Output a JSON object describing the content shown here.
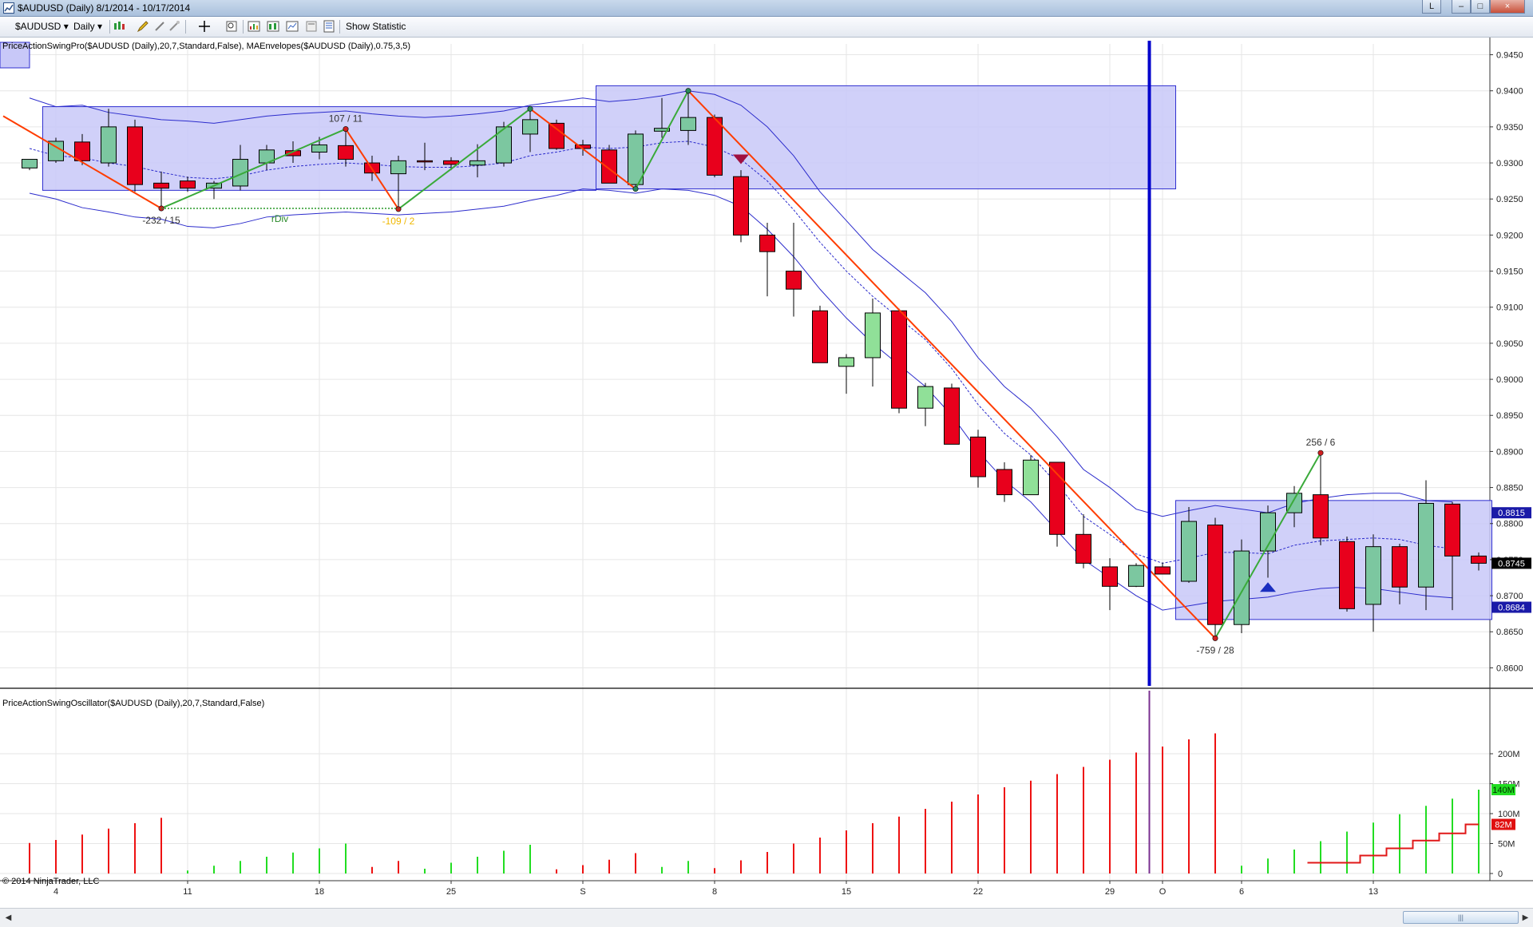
{
  "window": {
    "title": "$AUDUSD (Daily)  8/1/2014 - 10/17/2014",
    "buttons": [
      "L",
      "–",
      "□",
      "×"
    ]
  },
  "toolbar": {
    "instrument": "$AUDUSD",
    "period": "Daily",
    "show_statistic": "Show Statistic"
  },
  "price_panel": {
    "indicator_label": "PriceActionSwingPro($AUDUSD (Daily),20,7,Standard,False), MAEnvelopes($AUDUSD (Daily),0.75,3,5)",
    "copyright": "© 2014 NinjaTrader, LLC"
  },
  "oscillator_panel": {
    "indicator_label": "PriceActionSwingOscillator($AUDUSD (Daily),20,7,Standard,False)"
  },
  "colors": {
    "up_candle": "#7cc7a0",
    "up_candle_light": "#90e098",
    "down_candle": "#e8001c",
    "swing_up": "#3aaa3a",
    "swing_down": "#ff3c00",
    "box_fill": "#c8c8f8",
    "box_edge": "#3030d0",
    "envelope": "#2c2ccc",
    "marker_line": "#0000cc",
    "volume_up": "#22dd22",
    "volume_down": "#ee1111",
    "tag_blue": "#1a1aa8",
    "tag_black": "#000000",
    "tag_green": "#22dd22",
    "tag_red": "#e01010"
  },
  "chart_data": [
    {
      "type": "candlestick",
      "symbol": "$AUDUSD",
      "timeframe": "Daily",
      "ylim": [
        0.8575,
        0.9465
      ],
      "y_ticks": [
        "0.9450",
        "0.9400",
        "0.9350",
        "0.9300",
        "0.9250",
        "0.9200",
        "0.9150",
        "0.9100",
        "0.9050",
        "0.9000",
        "0.8950",
        "0.8900",
        "0.8850",
        "0.8800",
        "0.8750",
        "0.8700",
        "0.8650",
        "0.8600"
      ],
      "x_tick_labels": [
        "4",
        "11",
        "18",
        "25",
        "S",
        "8",
        "15",
        "22",
        "29",
        "O",
        "6",
        "13"
      ],
      "x_tick_index": [
        1,
        6,
        11,
        16,
        21,
        26,
        31,
        36,
        41,
        43,
        46,
        51
      ],
      "candles": [
        {
          "o": 0.9293,
          "h": 0.9305,
          "l": 0.929,
          "c": 0.9305
        },
        {
          "o": 0.9303,
          "h": 0.9335,
          "l": 0.93,
          "c": 0.933
        },
        {
          "o": 0.9329,
          "h": 0.934,
          "l": 0.9297,
          "c": 0.9303
        },
        {
          "o": 0.93,
          "h": 0.9375,
          "l": 0.9295,
          "c": 0.935
        },
        {
          "o": 0.935,
          "h": 0.936,
          "l": 0.926,
          "c": 0.927
        },
        {
          "o": 0.9272,
          "h": 0.9288,
          "l": 0.9238,
          "c": 0.9265
        },
        {
          "o": 0.9275,
          "h": 0.9281,
          "l": 0.926,
          "c": 0.9265
        },
        {
          "o": 0.9265,
          "h": 0.9275,
          "l": 0.925,
          "c": 0.9272
        },
        {
          "o": 0.9268,
          "h": 0.9325,
          "l": 0.9262,
          "c": 0.9305
        },
        {
          "o": 0.93,
          "h": 0.9325,
          "l": 0.929,
          "c": 0.9318
        },
        {
          "o": 0.9317,
          "h": 0.933,
          "l": 0.93,
          "c": 0.931
        },
        {
          "o": 0.9315,
          "h": 0.9336,
          "l": 0.9305,
          "c": 0.9325
        },
        {
          "o": 0.9324,
          "h": 0.9347,
          "l": 0.9295,
          "c": 0.9305
        },
        {
          "o": 0.93,
          "h": 0.931,
          "l": 0.9275,
          "c": 0.9286
        },
        {
          "o": 0.9285,
          "h": 0.931,
          "l": 0.9238,
          "c": 0.9303
        },
        {
          "o": 0.9303,
          "h": 0.9328,
          "l": 0.929,
          "c": 0.9302
        },
        {
          "o": 0.9303,
          "h": 0.9308,
          "l": 0.929,
          "c": 0.9298
        },
        {
          "o": 0.9297,
          "h": 0.9326,
          "l": 0.928,
          "c": 0.9303
        },
        {
          "o": 0.93,
          "h": 0.9357,
          "l": 0.9295,
          "c": 0.935
        },
        {
          "o": 0.934,
          "h": 0.9378,
          "l": 0.9315,
          "c": 0.936
        },
        {
          "o": 0.9355,
          "h": 0.936,
          "l": 0.9318,
          "c": 0.932
        },
        {
          "o": 0.9325,
          "h": 0.9332,
          "l": 0.931,
          "c": 0.932
        },
        {
          "o": 0.9318,
          "h": 0.9325,
          "l": 0.9275,
          "c": 0.9272
        },
        {
          "o": 0.927,
          "h": 0.9345,
          "l": 0.9262,
          "c": 0.934
        },
        {
          "o": 0.9344,
          "h": 0.939,
          "l": 0.9335,
          "c": 0.9348
        },
        {
          "o": 0.9345,
          "h": 0.94,
          "l": 0.9325,
          "c": 0.9363
        },
        {
          "o": 0.9363,
          "h": 0.9367,
          "l": 0.928,
          "c": 0.9283
        },
        {
          "o": 0.9281,
          "h": 0.929,
          "l": 0.919,
          "c": 0.92
        },
        {
          "o": 0.92,
          "h": 0.9217,
          "l": 0.9115,
          "c": 0.9177
        },
        {
          "o": 0.915,
          "h": 0.9217,
          "l": 0.9087,
          "c": 0.9125
        },
        {
          "o": 0.9095,
          "h": 0.9102,
          "l": 0.9023,
          "c": 0.9023
        },
        {
          "o": 0.9018,
          "h": 0.9035,
          "l": 0.898,
          "c": 0.903
        },
        {
          "o": 0.903,
          "h": 0.9112,
          "l": 0.899,
          "c": 0.9092
        },
        {
          "o": 0.9095,
          "h": 0.9098,
          "l": 0.8953,
          "c": 0.896
        },
        {
          "o": 0.896,
          "h": 0.8995,
          "l": 0.8935,
          "c": 0.899
        },
        {
          "o": 0.8988,
          "h": 0.8994,
          "l": 0.891,
          "c": 0.891
        },
        {
          "o": 0.892,
          "h": 0.893,
          "l": 0.885,
          "c": 0.8865
        },
        {
          "o": 0.8875,
          "h": 0.8885,
          "l": 0.883,
          "c": 0.884
        },
        {
          "o": 0.884,
          "h": 0.8895,
          "l": 0.884,
          "c": 0.8888
        },
        {
          "o": 0.8885,
          "h": 0.8885,
          "l": 0.8768,
          "c": 0.8785
        },
        {
          "o": 0.8785,
          "h": 0.8813,
          "l": 0.8738,
          "c": 0.8745
        },
        {
          "o": 0.874,
          "h": 0.8752,
          "l": 0.868,
          "c": 0.8713
        },
        {
          "o": 0.8713,
          "h": 0.8745,
          "l": 0.8712,
          "c": 0.8742
        },
        {
          "o": 0.874,
          "h": 0.8746,
          "l": 0.873,
          "c": 0.873
        },
        {
          "o": 0.872,
          "h": 0.8823,
          "l": 0.8718,
          "c": 0.8803
        },
        {
          "o": 0.8798,
          "h": 0.8808,
          "l": 0.864,
          "c": 0.866
        },
        {
          "o": 0.866,
          "h": 0.8778,
          "l": 0.8648,
          "c": 0.8762
        },
        {
          "o": 0.8762,
          "h": 0.8825,
          "l": 0.8725,
          "c": 0.8815
        },
        {
          "o": 0.8815,
          "h": 0.8852,
          "l": 0.8795,
          "c": 0.8842
        },
        {
          "o": 0.884,
          "h": 0.89,
          "l": 0.877,
          "c": 0.878
        },
        {
          "o": 0.8775,
          "h": 0.8782,
          "l": 0.8678,
          "c": 0.8682
        },
        {
          "o": 0.8688,
          "h": 0.8785,
          "l": 0.865,
          "c": 0.8768
        },
        {
          "o": 0.8768,
          "h": 0.8772,
          "l": 0.8688,
          "c": 0.8712
        },
        {
          "o": 0.8712,
          "h": 0.886,
          "l": 0.868,
          "c": 0.8828
        },
        {
          "o": 0.8827,
          "h": 0.883,
          "l": 0.868,
          "c": 0.8755
        },
        {
          "o": 0.8755,
          "h": 0.876,
          "l": 0.8735,
          "c": 0.8745
        }
      ],
      "light_up_candles": [
        31,
        32,
        34,
        38,
        43
      ],
      "envelope": {
        "upper": [
          0.939,
          0.9378,
          0.938,
          0.937,
          0.9365,
          0.936,
          0.9358,
          0.9355,
          0.936,
          0.9365,
          0.9368,
          0.937,
          0.9372,
          0.9368,
          0.9365,
          0.9363,
          0.9365,
          0.9368,
          0.9372,
          0.938,
          0.9385,
          0.939,
          0.9385,
          0.9388,
          0.9393,
          0.94,
          0.9395,
          0.938,
          0.935,
          0.931,
          0.926,
          0.922,
          0.918,
          0.915,
          0.912,
          0.908,
          0.903,
          0.899,
          0.896,
          0.892,
          0.8875,
          0.885,
          0.882,
          0.881,
          0.8818,
          0.8825,
          0.882,
          0.8815,
          0.8828,
          0.8835,
          0.884,
          0.8842,
          0.8842,
          0.8832,
          0.883
        ],
        "middle": [
          0.932,
          0.931,
          0.9307,
          0.93,
          0.9295,
          0.9287,
          0.928,
          0.9278,
          0.9282,
          0.929,
          0.9295,
          0.9298,
          0.93,
          0.9298,
          0.9295,
          0.9294,
          0.9294,
          0.9296,
          0.93,
          0.931,
          0.9315,
          0.9322,
          0.932,
          0.9322,
          0.9328,
          0.933,
          0.9322,
          0.9305,
          0.9275,
          0.9235,
          0.919,
          0.915,
          0.9115,
          0.9085,
          0.9055,
          0.9015,
          0.8965,
          0.8925,
          0.8895,
          0.8855,
          0.881,
          0.8785,
          0.8758,
          0.8745,
          0.8752,
          0.876,
          0.876,
          0.8758,
          0.877,
          0.8776,
          0.8778,
          0.878,
          0.8778,
          0.877,
          0.8765
        ],
        "lower": [
          0.9258,
          0.925,
          0.9238,
          0.9232,
          0.9225,
          0.9222,
          0.9212,
          0.921,
          0.9216,
          0.9225,
          0.9228,
          0.923,
          0.9232,
          0.923,
          0.9228,
          0.923,
          0.9232,
          0.9236,
          0.924,
          0.9248,
          0.9255,
          0.9264,
          0.9262,
          0.9258,
          0.9264,
          0.9262,
          0.9255,
          0.924,
          0.9208,
          0.917,
          0.9125,
          0.9085,
          0.905,
          0.902,
          0.899,
          0.895,
          0.89,
          0.886,
          0.883,
          0.879,
          0.875,
          0.8725,
          0.87,
          0.868,
          0.8686,
          0.8692,
          0.8695,
          0.8698,
          0.8705,
          0.871,
          0.8712,
          0.871,
          0.8705,
          0.87,
          0.8697
        ]
      },
      "consolidation_boxes": [
        {
          "from": 0.5,
          "to": 21.5,
          "top": 0.9378,
          "bottom": 0.9262
        },
        {
          "from": 21.5,
          "to": 43.5,
          "top": 0.9407,
          "bottom": 0.9264
        },
        {
          "from": 43.5,
          "to": 55.5,
          "top": 0.8832,
          "bottom": 0.8667
        }
      ],
      "zigzag": [
        {
          "i": -1,
          "v": 0.9365,
          "dir": "down"
        },
        {
          "i": 5,
          "v": 0.9237,
          "dir": "up"
        },
        {
          "i": 12,
          "v": 0.9347,
          "dir": "down"
        },
        {
          "i": 14,
          "v": 0.9236,
          "dir": "up"
        },
        {
          "i": 19,
          "v": 0.9375,
          "dir": "down"
        },
        {
          "i": 23,
          "v": 0.9264,
          "dir": "up"
        },
        {
          "i": 25,
          "v": 0.94,
          "dir": "down"
        },
        {
          "i": 45,
          "v": 0.8641,
          "dir": "up"
        },
        {
          "i": 49,
          "v": 0.8898,
          "dir": "end"
        }
      ],
      "swing_labels": [
        {
          "i": 5,
          "v": 0.9237,
          "text": "-232 / 15",
          "pos": "below",
          "color": "#333333"
        },
        {
          "i": 12,
          "v": 0.9347,
          "text": "107 / 11",
          "pos": "above",
          "color": "#333333"
        },
        {
          "i": 14,
          "v": 0.9236,
          "text": "-109 / 2",
          "pos": "below",
          "color": "#f0b800"
        },
        {
          "i": 45,
          "v": 0.8641,
          "text": "-759 / 28",
          "pos": "below",
          "color": "#333333"
        },
        {
          "i": 49,
          "v": 0.8898,
          "text": "256 / 6",
          "pos": "above",
          "color": "#333333"
        }
      ],
      "divergence": {
        "from": 5,
        "to": 14,
        "v": 0.9237,
        "label": "rDiv",
        "label_i": 9.5
      },
      "signals": [
        {
          "i": 27,
          "v": 0.9305,
          "shape": "down-triangle",
          "color": "#a01040"
        },
        {
          "i": 47,
          "v": 0.8712,
          "shape": "up-triangle",
          "color": "#1a2ec0"
        }
      ],
      "vertical_marker_i": 42.5,
      "price_tags": [
        {
          "v": 0.8815,
          "text": "0.8815",
          "color": "tag_blue"
        },
        {
          "v": 0.8745,
          "text": "0.8745",
          "color": "tag_black"
        },
        {
          "v": 0.8684,
          "text": "0.8684",
          "color": "tag_blue"
        }
      ]
    },
    {
      "type": "bar",
      "title": "PriceActionSwingOscillator",
      "ylim": [
        0,
        250
      ],
      "y_ticks": [
        "200M",
        "150M",
        "100M",
        "50M",
        "0"
      ],
      "bars": [
        {
          "v": 51,
          "c": "down"
        },
        {
          "v": 56,
          "c": "down"
        },
        {
          "v": 65,
          "c": "down"
        },
        {
          "v": 75,
          "c": "down"
        },
        {
          "v": 84,
          "c": "down"
        },
        {
          "v": 93,
          "c": "down"
        },
        {
          "v": 5,
          "c": "up"
        },
        {
          "v": 13,
          "c": "up"
        },
        {
          "v": 21,
          "c": "up"
        },
        {
          "v": 28,
          "c": "up"
        },
        {
          "v": 35,
          "c": "up"
        },
        {
          "v": 42,
          "c": "up"
        },
        {
          "v": 50,
          "c": "up"
        },
        {
          "v": 11,
          "c": "down"
        },
        {
          "v": 21,
          "c": "down"
        },
        {
          "v": 8,
          "c": "up"
        },
        {
          "v": 18,
          "c": "up"
        },
        {
          "v": 28,
          "c": "up"
        },
        {
          "v": 38,
          "c": "up"
        },
        {
          "v": 48,
          "c": "up"
        },
        {
          "v": 7,
          "c": "down"
        },
        {
          "v": 14,
          "c": "down"
        },
        {
          "v": 23,
          "c": "down"
        },
        {
          "v": 34,
          "c": "down"
        },
        {
          "v": 11,
          "c": "up"
        },
        {
          "v": 21,
          "c": "up"
        },
        {
          "v": 9,
          "c": "down"
        },
        {
          "v": 22,
          "c": "down"
        },
        {
          "v": 36,
          "c": "down"
        },
        {
          "v": 50,
          "c": "down"
        },
        {
          "v": 60,
          "c": "down"
        },
        {
          "v": 72,
          "c": "down"
        },
        {
          "v": 84,
          "c": "down"
        },
        {
          "v": 95,
          "c": "down"
        },
        {
          "v": 108,
          "c": "down"
        },
        {
          "v": 120,
          "c": "down"
        },
        {
          "v": 132,
          "c": "down"
        },
        {
          "v": 144,
          "c": "down"
        },
        {
          "v": 155,
          "c": "down"
        },
        {
          "v": 166,
          "c": "down"
        },
        {
          "v": 178,
          "c": "down"
        },
        {
          "v": 190,
          "c": "down"
        },
        {
          "v": 202,
          "c": "down"
        },
        {
          "v": 212,
          "c": "down"
        },
        {
          "v": 224,
          "c": "down"
        },
        {
          "v": 234,
          "c": "down"
        },
        {
          "v": 13,
          "c": "up"
        },
        {
          "v": 25,
          "c": "up"
        },
        {
          "v": 40,
          "c": "up"
        },
        {
          "v": 54,
          "c": "up"
        },
        {
          "v": 70,
          "c": "up"
        },
        {
          "v": 85,
          "c": "up"
        },
        {
          "v": 99,
          "c": "up"
        },
        {
          "v": 113,
          "c": "up"
        },
        {
          "v": 125,
          "c": "up"
        },
        {
          "v": 140,
          "c": "up"
        }
      ],
      "bars_x_index": [
        0,
        1,
        2,
        3,
        4,
        5,
        6,
        7,
        8,
        9,
        10,
        11,
        12,
        13,
        14,
        15,
        16,
        17,
        18,
        19,
        20,
        21,
        22,
        23,
        24,
        25,
        26,
        27,
        28,
        29,
        30,
        31,
        32,
        33,
        34,
        35,
        36,
        37,
        38,
        39,
        40,
        41,
        42,
        43,
        44,
        45,
        46,
        47,
        48,
        49,
        50,
        51,
        52,
        53,
        54,
        55
      ],
      "step_line": [
        {
          "i": 49.5,
          "v": 18
        },
        {
          "i": 50.5,
          "v": 30
        },
        {
          "i": 51.5,
          "v": 42
        },
        {
          "i": 52.5,
          "v": 55
        },
        {
          "i": 53.5,
          "v": 67
        },
        {
          "i": 54.5,
          "v": 82
        }
      ],
      "step_line_from_i": 48.5,
      "value_tags": [
        {
          "v": 140,
          "text": "140M",
          "color": "tag_green"
        },
        {
          "v": 82,
          "text": "82M",
          "color": "tag_red"
        }
      ]
    }
  ]
}
